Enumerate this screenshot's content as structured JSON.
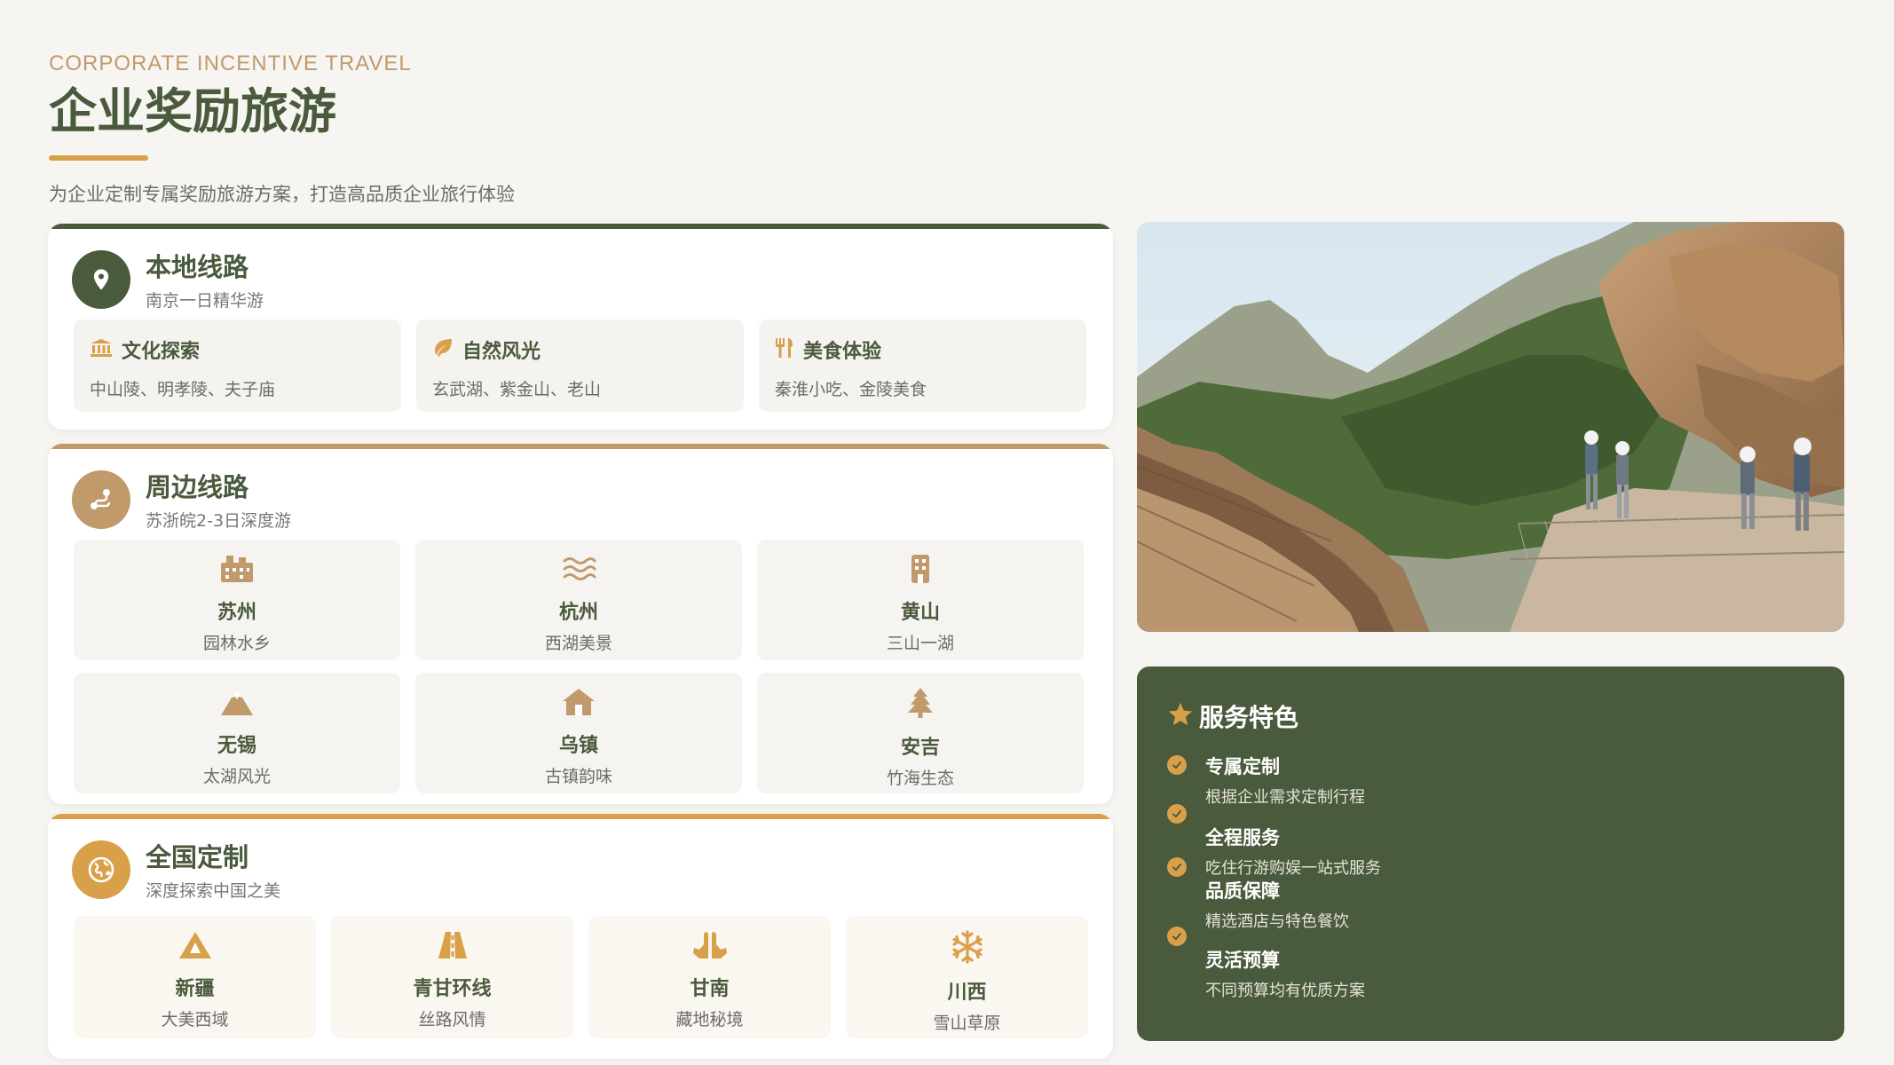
{
  "header": {
    "eyebrow": "CORPORATE INCENTIVE TRAVEL",
    "title": "企业奖励旅游",
    "subtitle": "为企业定制专属奖励旅游方案，打造高品质企业旅行体验"
  },
  "local": {
    "title": "本地线路",
    "subtitle": "南京一日精华游",
    "items": [
      {
        "title": "文化探索",
        "desc": "中山陵、明孝陵、夫子庙",
        "icon": "landmark-icon"
      },
      {
        "title": "自然风光",
        "desc": "玄武湖、紫金山、老山",
        "icon": "leaf-icon"
      },
      {
        "title": "美食体验",
        "desc": "秦淮小吃、金陵美食",
        "icon": "utensils-icon"
      }
    ]
  },
  "nearby": {
    "title": "周边线路",
    "subtitle": "苏浙皖2-3日深度游",
    "items": [
      {
        "title": "苏州",
        "desc": "园林水乡",
        "icon": "city-icon"
      },
      {
        "title": "杭州",
        "desc": "西湖美景",
        "icon": "water-icon"
      },
      {
        "title": "黄山",
        "desc": "三山一湖",
        "icon": "building-icon"
      },
      {
        "title": "无锡",
        "desc": "太湖风光",
        "icon": "mountain-icon"
      },
      {
        "title": "乌镇",
        "desc": "古镇韵味",
        "icon": "house-icon"
      },
      {
        "title": "安吉",
        "desc": "竹海生态",
        "icon": "tree-icon"
      }
    ]
  },
  "national": {
    "title": "全国定制",
    "subtitle": "深度探索中国之美",
    "items": [
      {
        "title": "新疆",
        "desc": "大美西域",
        "icon": "mountain-icon"
      },
      {
        "title": "青甘环线",
        "desc": "丝路风情",
        "icon": "road-icon"
      },
      {
        "title": "甘南",
        "desc": "藏地秘境",
        "icon": "praying-hands-icon"
      },
      {
        "title": "川西",
        "desc": "雪山草原",
        "icon": "snowflake-icon"
      }
    ]
  },
  "service": {
    "title": "服务特色",
    "items": [
      {
        "name": "专属定制",
        "desc": "根据企业需求定制行程"
      },
      {
        "name": "全程服务",
        "desc": "吃住行游购娱一站式服务"
      },
      {
        "name": "品质保障",
        "desc": "精选酒店与特色餐饮"
      },
      {
        "name": "灵活预算",
        "desc": "不同预算均有优质方案"
      }
    ]
  },
  "colors": {
    "primary": "#4a5a3c",
    "tan": "#c19a6b",
    "gold": "#d9a04a",
    "background": "#f7f5f1"
  }
}
